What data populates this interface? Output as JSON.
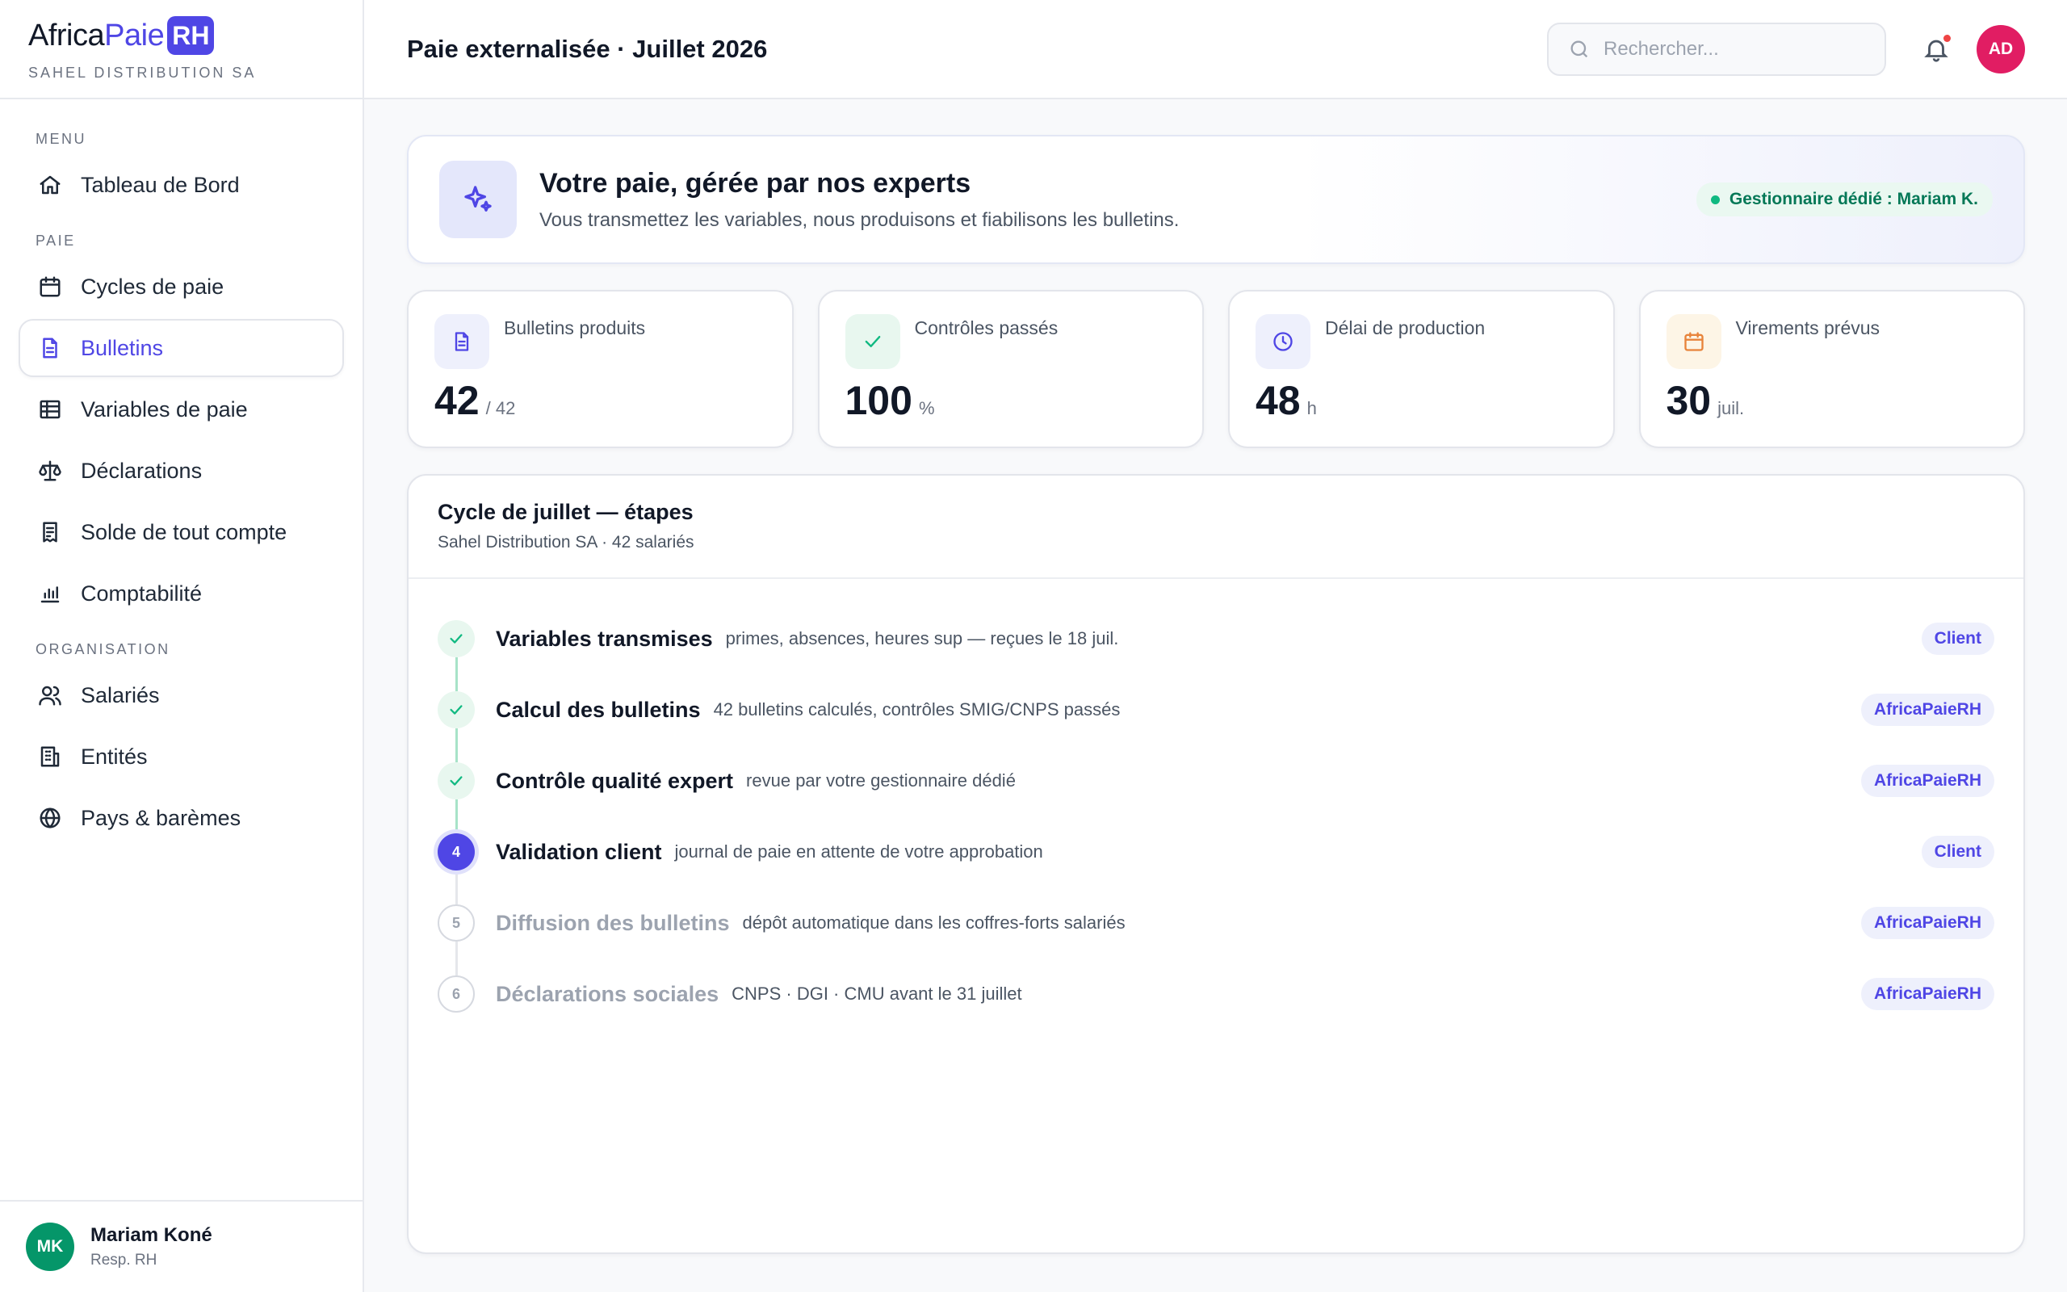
{
  "brand": {
    "part1": "Africa",
    "part2": "Paie",
    "part3": "RH",
    "company": "SAHEL DISTRIBUTION SA"
  },
  "sidebar": {
    "sections": [
      {
        "label": "MENU",
        "items": [
          {
            "label": "Tableau de Bord",
            "icon": "home-icon"
          }
        ]
      },
      {
        "label": "PAIE",
        "items": [
          {
            "label": "Cycles de paie",
            "icon": "calendar-icon"
          },
          {
            "label": "Bulletins",
            "icon": "document-icon",
            "active": true
          },
          {
            "label": "Variables de paie",
            "icon": "table-icon"
          },
          {
            "label": "Déclarations",
            "icon": "scale-icon"
          },
          {
            "label": "Solde de tout compte",
            "icon": "receipt-icon"
          },
          {
            "label": "Comptabilité",
            "icon": "bar-chart-icon"
          }
        ]
      },
      {
        "label": "ORGANISATION",
        "items": [
          {
            "label": "Salariés",
            "icon": "users-icon"
          },
          {
            "label": "Entités",
            "icon": "building-icon"
          },
          {
            "label": "Pays & barèmes",
            "icon": "globe-icon"
          }
        ]
      }
    ]
  },
  "user": {
    "initials": "MK",
    "name": "Mariam Koné",
    "role": "Resp. RH"
  },
  "header": {
    "title": "Paie externalisée · Juillet 2026",
    "search_placeholder": "Rechercher...",
    "avatar_initials": "AD"
  },
  "hero": {
    "title": "Votre paie, gérée par nos experts",
    "subtitle": "Vous transmettez les variables, nous produisons et fiabilisons les bulletins.",
    "badge": "Gestionnaire dédié : Mariam K."
  },
  "stats": [
    {
      "label": "Bulletins produits",
      "value": "42",
      "unit": "/ 42",
      "icon": "document-icon"
    },
    {
      "label": "Contrôles passés",
      "value": "100",
      "unit": "%",
      "icon": "check-icon"
    },
    {
      "label": "Délai de production",
      "value": "48",
      "unit": "h",
      "icon": "clock-icon"
    },
    {
      "label": "Virements prévus",
      "value": "30",
      "unit": "juil.",
      "icon": "calendar-icon"
    }
  ],
  "cycle": {
    "title": "Cycle de juillet — étapes",
    "subtitle": "Sahel Distribution SA · 42 salariés",
    "steps": [
      {
        "number": "1",
        "status": "done",
        "name": "Variables transmises",
        "desc": "primes, absences, heures sup — reçues le 18 juil.",
        "owner": "Client"
      },
      {
        "number": "2",
        "status": "done",
        "name": "Calcul des bulletins",
        "desc": "42 bulletins calculés, contrôles SMIG/CNPS passés",
        "owner": "AfricaPaieRH"
      },
      {
        "number": "3",
        "status": "done",
        "name": "Contrôle qualité expert",
        "desc": "revue par votre gestionnaire dédié",
        "owner": "AfricaPaieRH"
      },
      {
        "number": "4",
        "status": "current",
        "name": "Validation client",
        "desc": "journal de paie en attente de votre approbation",
        "owner": "Client"
      },
      {
        "number": "5",
        "status": "todo",
        "name": "Diffusion des bulletins",
        "desc": "dépôt automatique dans les coffres-forts salariés",
        "owner": "AfricaPaieRH"
      },
      {
        "number": "6",
        "status": "todo",
        "name": "Déclarations sociales",
        "desc": "CNPS · DGI · CMU avant le 31 juillet",
        "owner": "AfricaPaieRH"
      }
    ]
  },
  "colors": {
    "accent": "#4f46e5",
    "success": "#10b981",
    "alert": "#ef4444",
    "avatar_user": "#059669",
    "avatar_admin": "#e11d63"
  }
}
